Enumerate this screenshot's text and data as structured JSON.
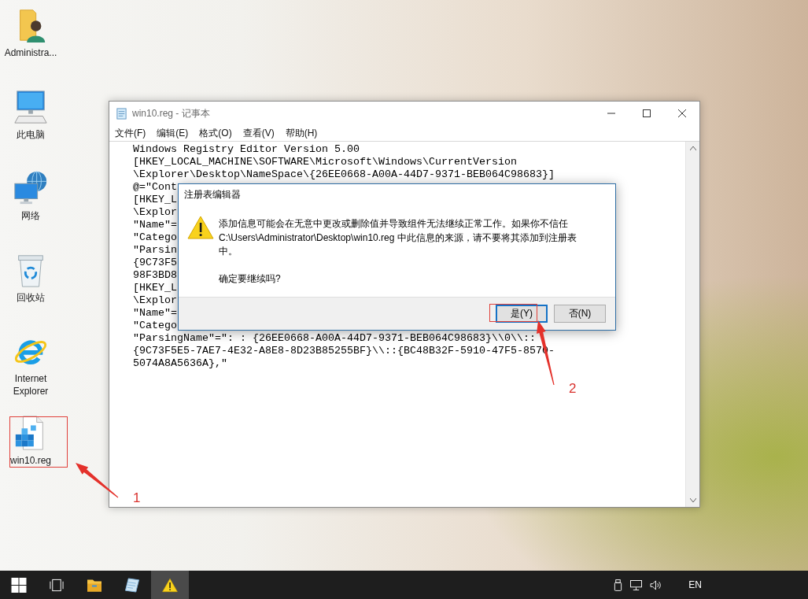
{
  "desktop": {
    "icons": [
      {
        "kind": "user-folder",
        "label": "Administra..."
      },
      {
        "kind": "computer",
        "label": "此电脑"
      },
      {
        "kind": "network",
        "label": "网络"
      },
      {
        "kind": "recycle-bin",
        "label": "回收站"
      },
      {
        "kind": "browser",
        "label": "Internet Explorer"
      },
      {
        "kind": "reg-file",
        "label": "win10.reg"
      }
    ]
  },
  "notepad": {
    "title": "win10.reg - 记事本",
    "menu": [
      "文件(F)",
      "编辑(E)",
      "格式(O)",
      "查看(V)",
      "帮助(H)"
    ],
    "lines": [
      "Windows Registry Editor Version 5.00",
      "[HKEY_LOCAL_MACHINE\\SOFTWARE\\Microsoft\\Windows\\CurrentVersion",
      "\\Explorer\\Desktop\\NameSpace\\{26EE0668-A00A-44D7-9371-BEB064C98683}]",
      "@=\"Cont",
      "[HKEY_L",
      "\\Explor",
      "\"Name\"=",
      "\"Catego",
      "\"Parsin",
      "{9C73F5",
      "98F3BD8",
      "[HKEY_L",
      "\\Explor",
      "\"Name\"=",
      "\"Catego",
      "\"ParsingName\"=\": : {26EE0668-A00A-44D7-9371-BEB064C98683}\\\\0\\\\::",
      "{9C73F5E5-7AE7-4E32-A8E8-8D23B85255BF}\\\\::{BC48B32F-5910-47F5-8570-",
      "5074A8A5636A},\""
    ]
  },
  "dialog": {
    "title": "注册表编辑器",
    "message": "添加信息可能会在无意中更改或删除值并导致组件无法继续正常工作。如果你不信任 C:\\Users\\Administrator\\Desktop\\win10.reg 中此信息的来源，请不要将其添加到注册表中。",
    "question": "确定要继续吗?",
    "buttons": [
      {
        "label": "是(Y)",
        "focused": true
      },
      {
        "label": "否(N)",
        "focused": false
      }
    ]
  },
  "annotations": [
    {
      "number": "1"
    },
    {
      "number": "2"
    }
  ],
  "taskbar": {
    "apps": [
      {
        "kind": "start",
        "active": false
      },
      {
        "kind": "task-view",
        "active": false
      },
      {
        "kind": "file-explorer",
        "active": false
      },
      {
        "kind": "notepad",
        "active": false
      },
      {
        "kind": "warning",
        "active": true
      }
    ],
    "tray": {
      "language": "EN"
    }
  }
}
